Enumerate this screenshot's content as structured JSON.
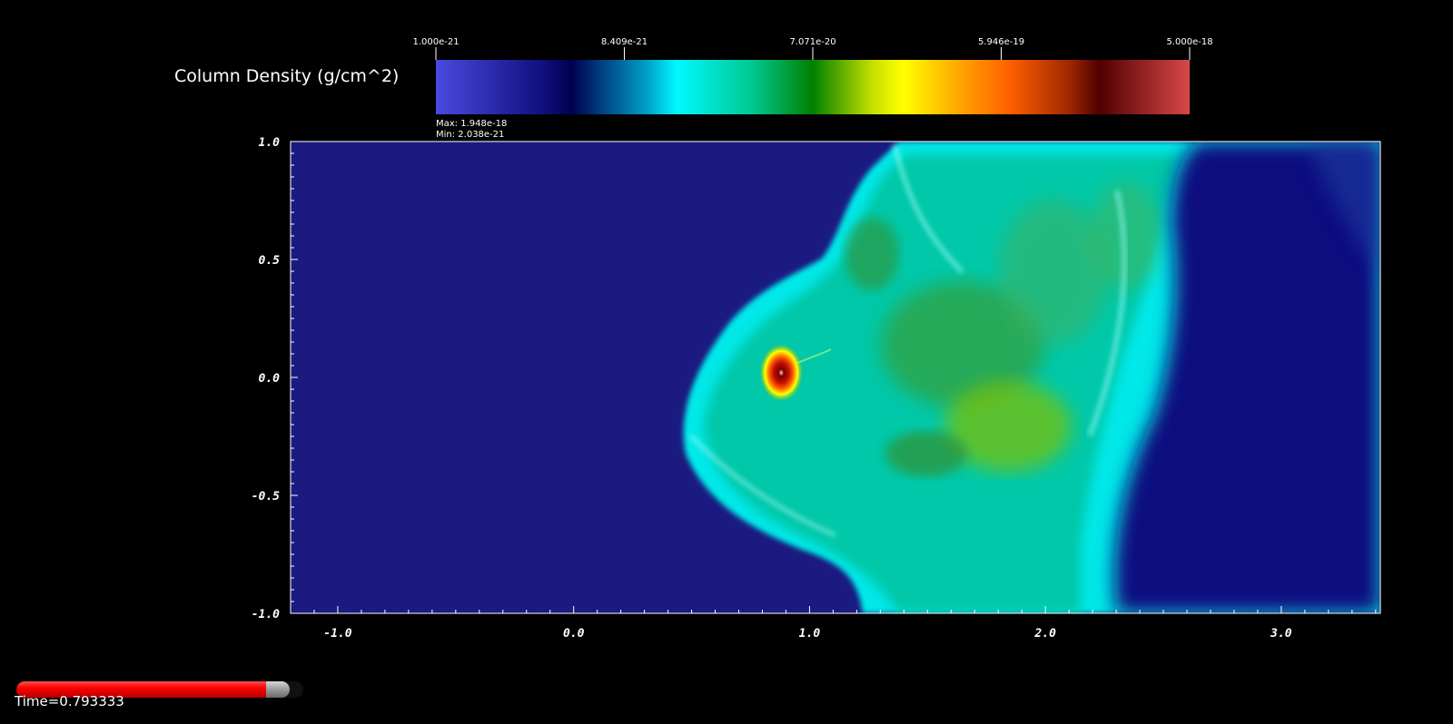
{
  "chart_data": {
    "type": "heatmap",
    "colorbar": {
      "title": "Column Density (g/cm^2)",
      "tick_labels": [
        "1.000e-21",
        "8.409e-21",
        "7.071e-20",
        "5.946e-19",
        "5.000e-18"
      ],
      "range": [
        1e-21,
        5e-18
      ],
      "scale": "log",
      "colormap": [
        "#4a4ae0",
        "#101080",
        "#000050",
        "#00e8ff",
        "#00c8a0",
        "#008000",
        "#ffff00",
        "#ff6000",
        "#600000",
        "#d84848"
      ],
      "max_label": "Max:  1.948e-18",
      "min_label": "Min:  2.038e-21"
    },
    "x_ticks": [
      "-1.0",
      "0.0",
      "1.0",
      "2.0",
      "3.0"
    ],
    "x_tick_values": [
      -1.0,
      0.0,
      1.0,
      2.0,
      3.0
    ],
    "y_ticks": [
      "1.0",
      "0.5",
      "0.0",
      "-0.5",
      "-1.0"
    ],
    "y_tick_values": [
      1.0,
      0.5,
      0.0,
      -0.5,
      -1.0
    ],
    "xlim": [
      -1.2,
      3.42
    ],
    "ylim": [
      -1.0,
      1.0
    ],
    "background_value": 1.2e-21,
    "peak": {
      "x": 0.88,
      "y": 0.02,
      "value": 1.948e-18
    }
  },
  "player": {
    "time_label": "Time=0.793333",
    "progress": 0.93
  }
}
